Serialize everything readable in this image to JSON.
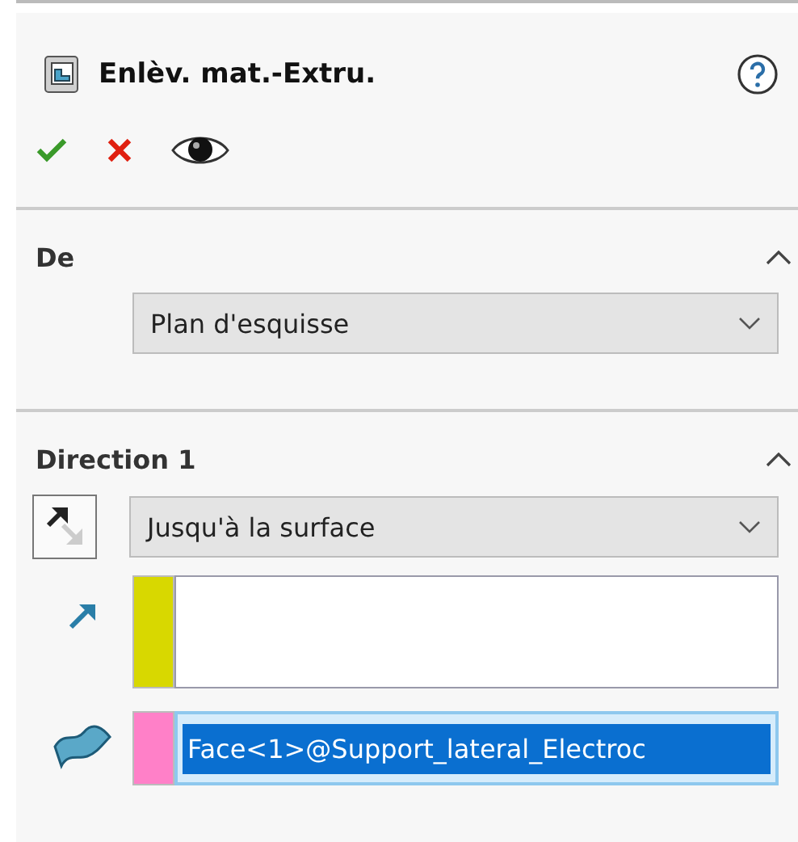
{
  "header": {
    "title": "Enlèv. mat.-Extru."
  },
  "sections": [
    {
      "title": "De",
      "expanded": true,
      "start": {
        "value": "Plan d'esquisse"
      }
    },
    {
      "title": "Direction 1",
      "expanded": true,
      "end": {
        "value": "Jusqu'à la surface"
      },
      "boxes": [
        {
          "kind": "list",
          "color": "#d8d800"
        },
        {
          "kind": "field",
          "color": "#ff80c8",
          "value": "Face<1>@Support_lateral_Electroc",
          "selected": true
        }
      ]
    }
  ]
}
